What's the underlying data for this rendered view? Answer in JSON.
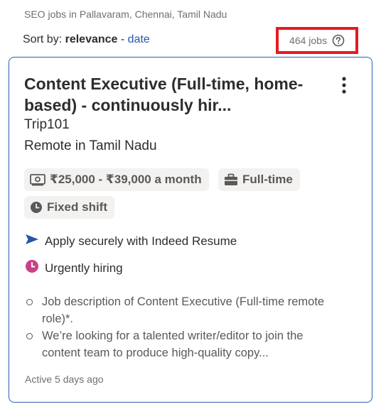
{
  "header": {
    "search_caption": "SEO jobs in Pallavaram, Chennai, Tamil Nadu",
    "sort_prefix": "Sort by:",
    "sort_selected": "relevance",
    "sort_separator": "-",
    "sort_alternative": "date",
    "job_count": "464 jobs",
    "help_icon": "question-circle-icon"
  },
  "job_card": {
    "title": "Content Executive (Full-time, home-based) - continuously hir...",
    "company": "Trip101",
    "location": "Remote in Tamil Nadu",
    "chips": {
      "salary": "₹25,000 - ₹39,000 a month",
      "job_type": "Full-time",
      "shift": "Fixed shift"
    },
    "features": {
      "apply": "Apply securely with Indeed Resume",
      "urgent": "Urgently hiring"
    },
    "snippet": [
      "Job description of Content Executive (Full-time remote role)*.",
      "We’re looking for a talented writer/editor to join the content team to produce high-quality copy..."
    ],
    "active": "Active 5 days ago"
  },
  "colors": {
    "link": "#2557a7",
    "highlight_border": "#e41b23",
    "card_border": "#2d5fb0",
    "urgent_icon": "#c74289"
  }
}
